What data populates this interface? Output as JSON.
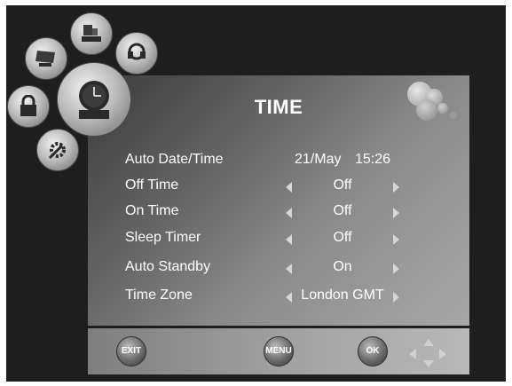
{
  "menu": {
    "title": "TIME",
    "rows": [
      {
        "label": "Auto Date/Time",
        "date": "21/May",
        "time": "15:26"
      },
      {
        "label": "Off Time",
        "value": "Off"
      },
      {
        "label": "On Time",
        "value": "Off"
      },
      {
        "label": "Sleep Timer",
        "value": "Off"
      },
      {
        "label": "Auto Standby",
        "value": "On"
      },
      {
        "label": "Time Zone",
        "value": "London GMT"
      }
    ]
  },
  "buttons": {
    "exit": "EXIT",
    "menu": "MENU",
    "ok": "OK"
  },
  "icons": {
    "selected": "clock-icon",
    "others": [
      "picture-icon",
      "channel-icon",
      "sound-icon",
      "lock-icon",
      "setup-icon"
    ]
  }
}
